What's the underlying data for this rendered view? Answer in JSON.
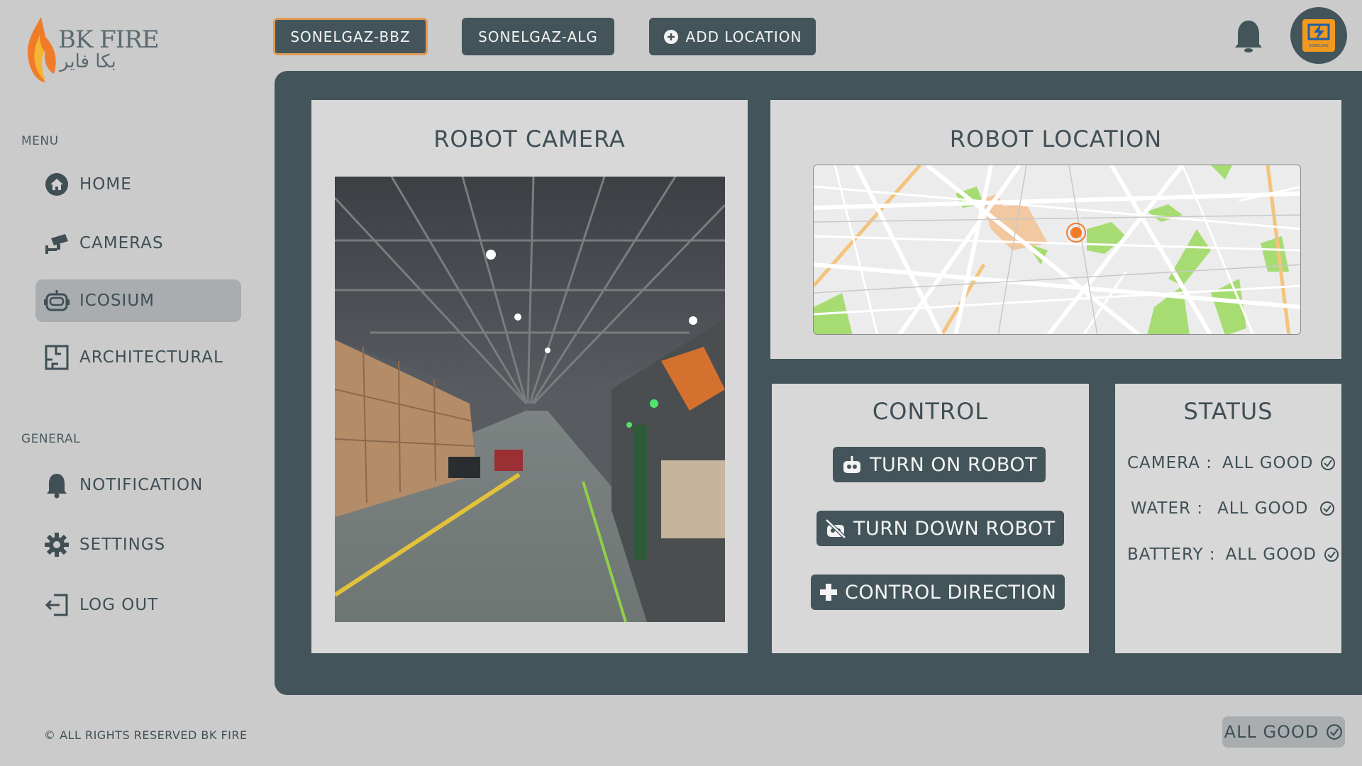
{
  "brand": {
    "name": "BK FIRE",
    "name_arabic": "بكا فاير"
  },
  "sidebar": {
    "menu_label": "MENU",
    "menu_items": [
      {
        "label": "HOME",
        "icon": "home-icon"
      },
      {
        "label": "CAMERAS",
        "icon": "cctv-camera-icon"
      },
      {
        "label": "ICOSIUM",
        "icon": "robot-icon",
        "active": true
      },
      {
        "label": "ARCHITECTURAL",
        "icon": "floor-plan-icon"
      }
    ],
    "general_label": "GENERAL",
    "general_items": [
      {
        "label": "NOTIFICATION",
        "icon": "bell-icon"
      },
      {
        "label": "SETTINGS",
        "icon": "gear-icon"
      },
      {
        "label": "LOG OUT",
        "icon": "logout-icon"
      }
    ],
    "footer": "© ALL RIGHTS RESERVED BK FIRE"
  },
  "header": {
    "tabs": [
      {
        "label": "SONELGAZ-BBZ",
        "active": true
      },
      {
        "label": "SONELGAZ-ALG",
        "active": false
      }
    ],
    "add_location_label": "ADD LOCATION",
    "avatar_label": "SONELGAZ"
  },
  "camera": {
    "title": "ROBOT CAMERA"
  },
  "location": {
    "title": "ROBOT LOCATION"
  },
  "control": {
    "title": "CONTROL",
    "buttons": [
      {
        "label": "TURN ON ROBOT",
        "icon": "robot-icon"
      },
      {
        "label": "TURN DOWN ROBOT",
        "icon": "robot-off-icon"
      },
      {
        "label": "CONTROL DIRECTION",
        "icon": "dpad-icon"
      }
    ]
  },
  "status": {
    "title": "STATUS",
    "rows": [
      {
        "key": "CAMERA :",
        "value": "ALL GOOD"
      },
      {
        "key": "WATER :",
        "value": "ALL GOOD"
      },
      {
        "key": "BATTERY :",
        "value": "ALL GOOD"
      }
    ]
  },
  "global_status": "ALL GOOD",
  "colors": {
    "panel": "#43555b",
    "accent": "#e29a55",
    "background": "#cbcbcb",
    "card": "#d8d8d8"
  }
}
